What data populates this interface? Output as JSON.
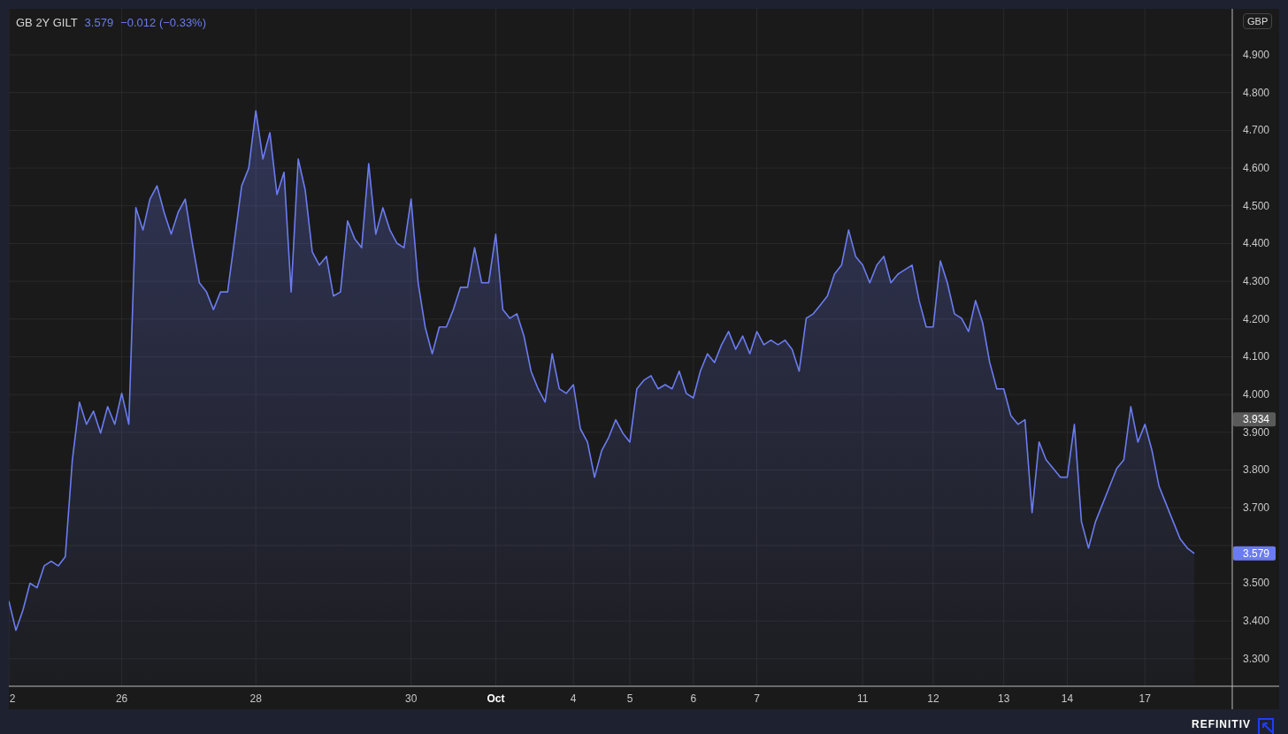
{
  "header": {
    "price": "3.579",
    "change": "−0.012 (−0.33%)"
  },
  "currency": "GBP",
  "chart_data": {
    "type": "area",
    "series": [
      {
        "name": "GB 2Y GILT",
        "color": "#6b7cf0",
        "values": [
          3.453,
          3.375,
          3.429,
          3.5,
          3.488,
          3.546,
          3.558,
          3.546,
          3.57,
          3.827,
          3.98,
          3.921,
          3.956,
          3.898,
          3.968,
          3.921,
          4.003,
          3.921,
          4.495,
          4.436,
          4.518,
          4.553,
          4.483,
          4.425,
          4.483,
          4.518,
          4.401,
          4.296,
          4.272,
          4.225,
          4.272,
          4.272,
          4.413,
          4.553,
          4.6,
          4.752,
          4.624,
          4.694,
          4.53,
          4.589,
          4.272,
          4.624,
          4.542,
          4.378,
          4.343,
          4.366,
          4.261,
          4.272,
          4.46,
          4.413,
          4.389,
          4.612,
          4.425,
          4.495,
          4.436,
          4.401,
          4.389,
          4.518,
          4.296,
          4.179,
          4.108,
          4.179,
          4.179,
          4.225,
          4.284,
          4.284,
          4.389,
          4.296,
          4.296,
          4.425,
          4.225,
          4.202,
          4.214,
          4.155,
          4.062,
          4.015,
          3.98,
          4.108,
          4.015,
          4.003,
          4.026,
          3.909,
          3.874,
          3.781,
          3.851,
          3.886,
          3.933,
          3.898,
          3.874,
          4.015,
          4.038,
          4.05,
          4.015,
          4.026,
          4.015,
          4.062,
          4.003,
          3.991,
          4.062,
          4.108,
          4.085,
          4.132,
          4.167,
          4.12,
          4.155,
          4.108,
          4.167,
          4.132,
          4.144,
          4.132,
          4.144,
          4.12,
          4.062,
          4.202,
          4.214,
          4.237,
          4.261,
          4.319,
          4.343,
          4.436,
          4.366,
          4.343,
          4.296,
          4.343,
          4.366,
          4.296,
          4.319,
          4.331,
          4.343,
          4.249,
          4.179,
          4.179,
          4.354,
          4.296,
          4.214,
          4.202,
          4.167,
          4.249,
          4.19,
          4.085,
          4.015,
          4.015,
          3.944,
          3.921,
          3.933,
          3.687,
          3.874,
          3.827,
          3.804,
          3.781,
          3.781,
          3.921,
          3.663,
          3.593,
          3.663,
          3.71,
          3.757,
          3.804,
          3.827,
          3.968,
          3.874,
          3.921,
          3.851,
          3.757,
          3.71,
          3.663,
          3.617,
          3.593,
          3.579
        ]
      }
    ],
    "ylim": [
      3.227,
      5.022
    ],
    "grid": true,
    "categories": [
      "2",
      null,
      null,
      null,
      null,
      null,
      null,
      null,
      null,
      null,
      null,
      null,
      null,
      null,
      null,
      null,
      "26",
      null,
      null,
      null,
      null,
      null,
      null,
      null,
      null,
      null,
      null,
      null,
      null,
      null,
      null,
      null,
      null,
      null,
      null,
      "28",
      null,
      null,
      null,
      null,
      null,
      null,
      null,
      null,
      null,
      null,
      null,
      null,
      null,
      null,
      null,
      null,
      null,
      null,
      null,
      null,
      null,
      "30",
      null,
      null,
      null,
      null,
      null,
      null,
      null,
      null,
      null,
      null,
      null,
      "Oct",
      null,
      null,
      null,
      null,
      null,
      null,
      null,
      null,
      null,
      null,
      "4",
      null,
      null,
      null,
      null,
      null,
      null,
      null,
      "5",
      null,
      null,
      null,
      null,
      null,
      null,
      null,
      null,
      "6",
      null,
      null,
      null,
      null,
      null,
      null,
      null,
      null,
      "7",
      null,
      null,
      null,
      null,
      null,
      null,
      null,
      null,
      null,
      null,
      null,
      null,
      null,
      null,
      "11",
      null,
      null,
      null,
      null,
      null,
      null,
      null,
      null,
      null,
      "12",
      null,
      null,
      null,
      null,
      null,
      null,
      null,
      null,
      null,
      "13",
      null,
      null,
      null,
      null,
      null,
      null,
      null,
      null,
      "14",
      null,
      null,
      null,
      null,
      null,
      null,
      null,
      null,
      null,
      null,
      "17",
      null,
      null,
      null,
      null,
      null,
      null,
      null
    ],
    "yticks": [
      {
        "value": 3.3,
        "label": "3.300"
      },
      {
        "value": 3.4,
        "label": "3.400"
      },
      {
        "value": 3.5,
        "label": "3.500"
      },
      {
        "value": 3.7,
        "label": "3.700"
      },
      {
        "value": 3.8,
        "label": "3.800"
      },
      {
        "value": 3.9,
        "label": "3.900"
      },
      {
        "value": 4.0,
        "label": "4.000"
      },
      {
        "value": 4.1,
        "label": "4.100"
      },
      {
        "value": 4.2,
        "label": "4.200"
      },
      {
        "value": 4.3,
        "label": "4.300"
      },
      {
        "value": 4.4,
        "label": "4.400"
      },
      {
        "value": 4.5,
        "label": "4.500"
      },
      {
        "value": 4.6,
        "label": "4.600"
      },
      {
        "value": 4.7,
        "label": "4.700"
      },
      {
        "value": 4.8,
        "label": "4.800"
      },
      {
        "value": 4.9,
        "label": "4.900"
      }
    ]
  },
  "price_markers": [
    {
      "kind": "crosshair",
      "value": "3.934"
    },
    {
      "kind": "last-price",
      "value": "3.579"
    }
  ],
  "branding": {
    "logo_text": "REFINITIV"
  }
}
